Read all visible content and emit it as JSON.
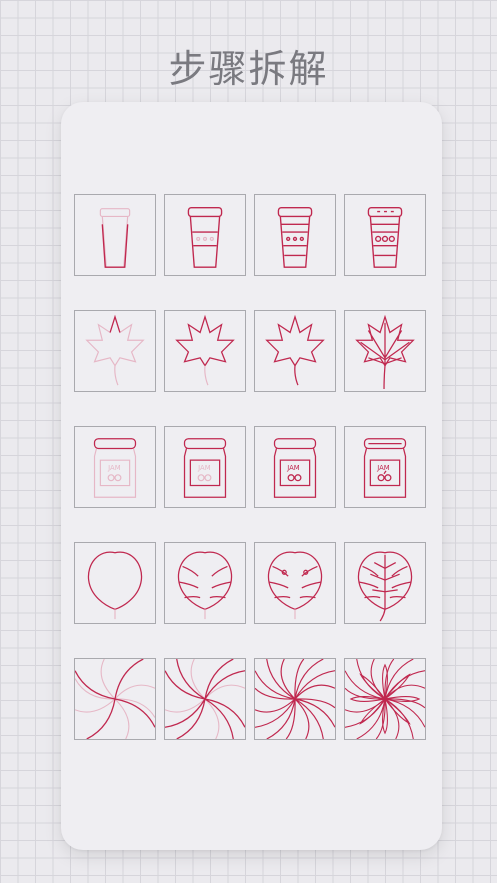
{
  "title": "步骤拆解",
  "stroke_color": "#c0284f",
  "faint_color": "#e6b7c6",
  "rows": [
    {
      "name": "coffee-cup",
      "icon": "coffee-cup-icon",
      "steps": [
        1,
        2,
        3,
        4
      ]
    },
    {
      "name": "maple-leaf",
      "icon": "maple-leaf-icon",
      "steps": [
        1,
        2,
        3,
        4
      ]
    },
    {
      "name": "jam-jar",
      "icon": "jam-jar-icon",
      "steps": [
        1,
        2,
        3,
        4
      ],
      "label": "JAM"
    },
    {
      "name": "monstera-leaf",
      "icon": "monstera-leaf-icon",
      "steps": [
        1,
        2,
        3,
        4
      ]
    },
    {
      "name": "swirl-flower",
      "icon": "swirl-flower-icon",
      "steps": [
        1,
        2,
        3,
        4
      ]
    }
  ]
}
